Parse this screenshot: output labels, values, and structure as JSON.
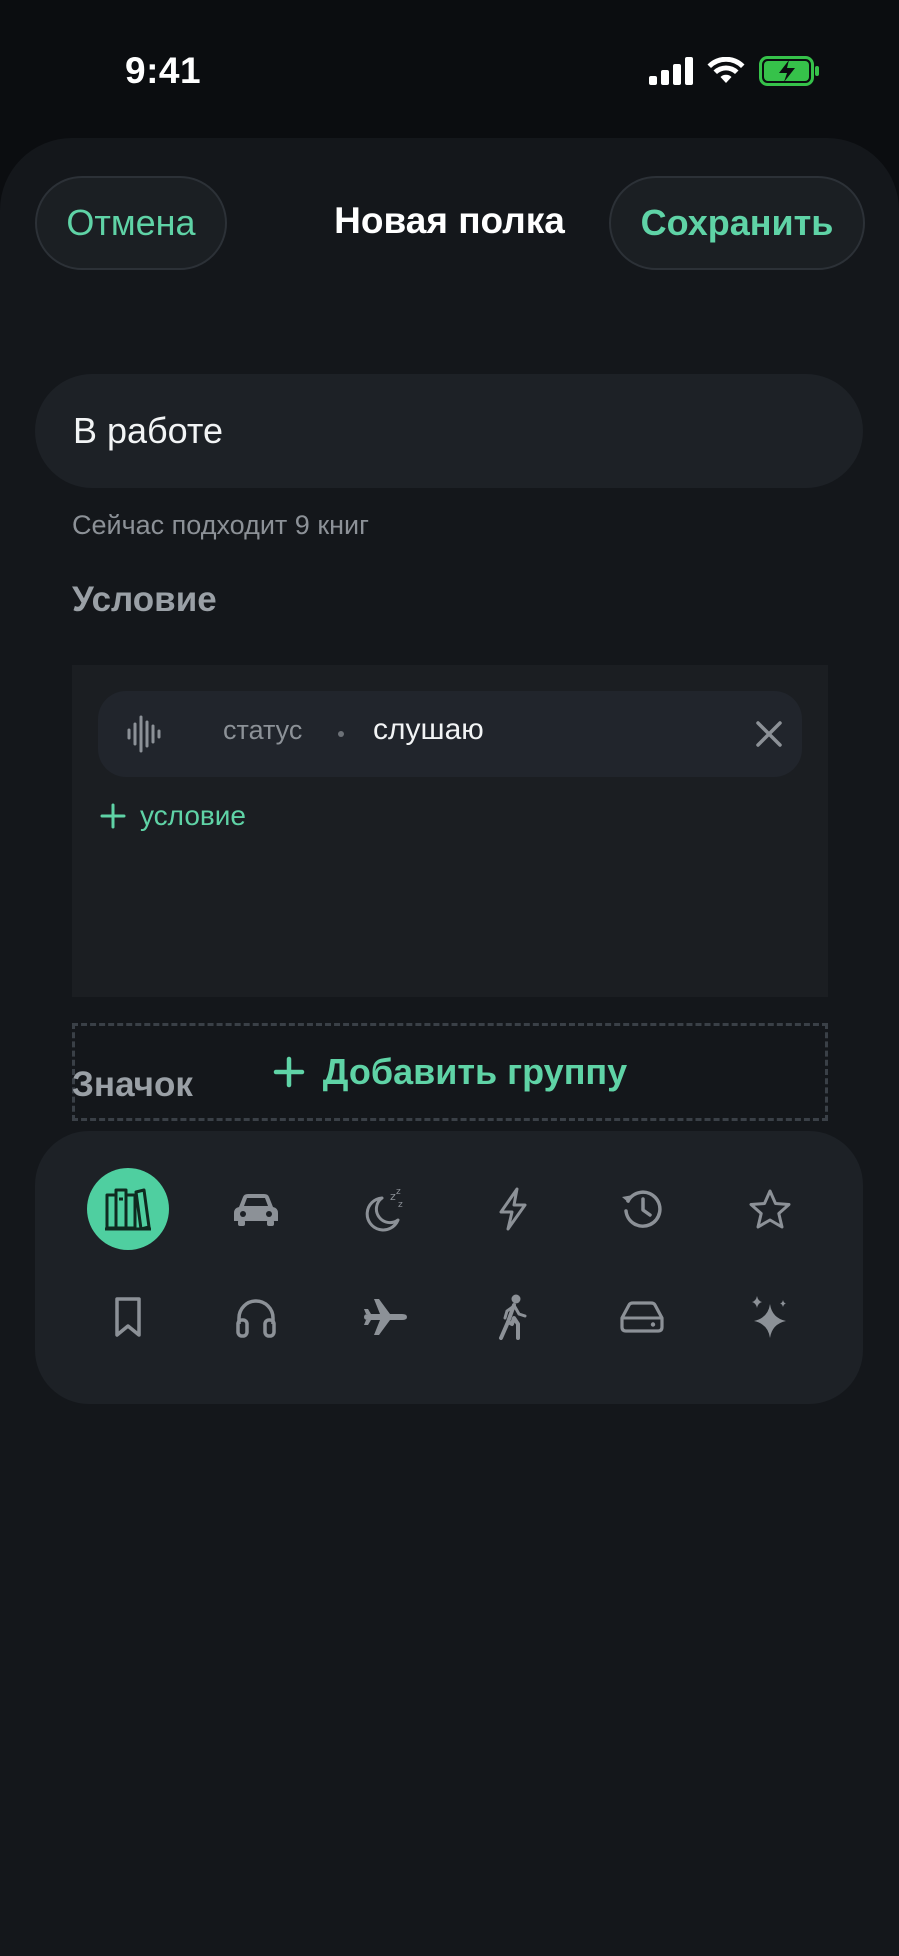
{
  "status_bar": {
    "time": "9:41"
  },
  "header": {
    "cancel_label": "Отмена",
    "title": "Новая полка",
    "save_label": "Сохранить"
  },
  "shelf": {
    "name_value": "В работе",
    "hint": "Сейчас подходит 9 книг"
  },
  "conditions": {
    "section_title": "Условие",
    "rules": [
      {
        "icon": "waveform-icon",
        "field": "статус",
        "value": "слушаю"
      }
    ],
    "add_condition_label": "условие",
    "add_group_label": "Добавить группу"
  },
  "icon_picker": {
    "section_title": "Значок",
    "selected_index": 0,
    "icons": [
      "books-icon",
      "car-icon",
      "moon-sleep-icon",
      "bolt-icon",
      "history-icon",
      "star-icon",
      "bookmark-icon",
      "headphones-icon",
      "airplane-icon",
      "walking-icon",
      "drive-icon",
      "sparkles-icon"
    ]
  },
  "colors": {
    "accent": "#5fd3a6",
    "selected_icon_bg": "#4fcfa0",
    "background": "#0b0d10",
    "sheet": "#14171b"
  }
}
